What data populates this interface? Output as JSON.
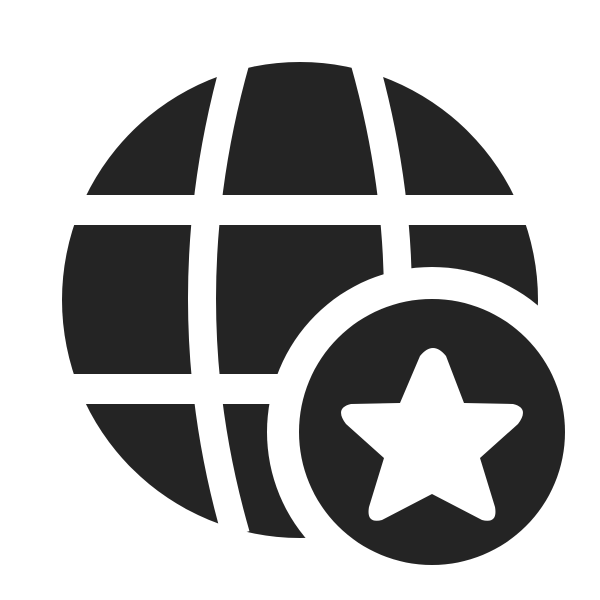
{
  "icon": {
    "name": "globe-star-icon",
    "parts": [
      "globe-icon",
      "star-badge-icon"
    ],
    "colors": {
      "foreground": "#242424",
      "background": "#ffffff"
    }
  }
}
